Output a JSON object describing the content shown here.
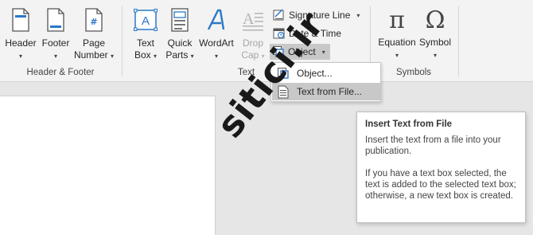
{
  "ribbon": {
    "header_footer_group": {
      "label": "Header & Footer",
      "header": {
        "label": "Header",
        "caret": "▾"
      },
      "footer": {
        "label": "Footer",
        "caret": "▾"
      },
      "page_number": {
        "label_line1": "Page",
        "label_line2": "Number",
        "caret": "▾"
      }
    },
    "text_group": {
      "label": "Text",
      "text_box": {
        "label_line1": "Text",
        "label_line2": "Box",
        "caret": "▾"
      },
      "quick_parts": {
        "label_line1": "Quick",
        "label_line2": "Parts",
        "caret": "▾"
      },
      "wordart": {
        "label": "WordArt",
        "caret": "▾"
      },
      "drop_cap": {
        "label_line1": "Drop",
        "label_line2": "Cap",
        "caret": "▾"
      },
      "signature_line": {
        "label": "Signature Line",
        "caret": "▾"
      },
      "date_time": {
        "label": "Date & Time"
      },
      "object": {
        "label": "Object",
        "caret": "▾"
      }
    },
    "symbols_group": {
      "label": "Symbols",
      "equation": {
        "label": "Equation",
        "caret": "▾",
        "glyph": "π"
      },
      "symbol": {
        "label": "Symbol",
        "caret": "▾",
        "glyph": "Ω"
      }
    }
  },
  "object_menu": {
    "items": [
      {
        "label": "Object..."
      },
      {
        "label": "Text from File..."
      }
    ]
  },
  "tooltip": {
    "title": "Insert Text from File",
    "line1": "Insert the text from a file into your publication.",
    "line2": "If you have a text box selected, the text is added to the selected text box; otherwise, a new text box is created."
  },
  "watermark": {
    "text": "sitici.ir"
  },
  "colors": {
    "accent_blue": "#2b78c6",
    "ribbon_bg": "#f3f3f3",
    "workspace_bg": "#e6e6e6",
    "hover_gray": "#c8c8c8"
  }
}
